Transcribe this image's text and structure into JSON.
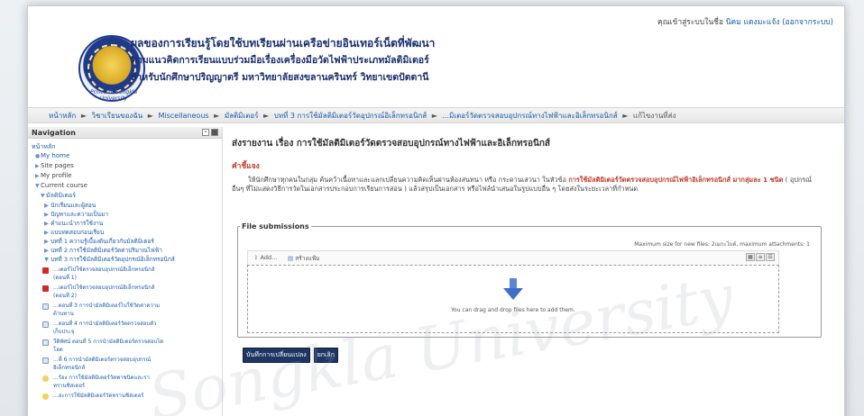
{
  "header": {
    "title_line1": "ผลของการเรียนรู้โดยใช้บทเรียนผ่านเครือข่ายอินเทอร์เน็ตที่พัฒนา",
    "title_line2": "ตามแนวคิดการเรียนแบบร่วมมือเรื่องเครื่องมือวัดไฟฟ้าประเภทมัลติมิเตอร์",
    "title_line3": "สำหรับนักศึกษาปริญญาตรี มหาวิทยาลัยสงขลานครินทร์ วิทยาเขตปัตตานี",
    "logo_caption": "Prince of Songkla University",
    "login_prefix": "คุณเข้าสู่ระบบในชื่อ",
    "login_user": "นิคม แดงมะแจ้ง",
    "logout_link": "(ออกจากระบบ)"
  },
  "breadcrumb": {
    "items": [
      "หน้าหลัก",
      "วิชาเรียนของฉัน",
      "Miscellaneous",
      "มัลติมิเตอร์",
      "บทที่ 3 การใช้มัลติมิเตอร์วัดอุปกรณ์อิเล็กทรอนิกส์",
      "...มิเตอร์วัดตรวจสอบอุปกรณ์ทางไฟฟ้าและอิเล็กทรอนิกส์",
      "แก้ไขงานที่ส่ง"
    ],
    "separator": "►"
  },
  "navigation": {
    "title": "Navigation",
    "home": "หน้าหลัก",
    "my_home": "My home",
    "site_pages": "Site pages",
    "my_profile": "My profile",
    "current_course": "Current course",
    "course": "มัลติมิเตอร์",
    "sections": [
      "นักเรียนและผู้สอน",
      "ปัญหาและความเป็นมา",
      "คำแนะนำการใช้งาน",
      "แบบทดสอบก่อนเรียน",
      "บทที่ 1 ความรู้เบื้องต้นเกี่ยวกับมัลติมิเตอร์",
      "บทที่ 2 การใช้มัลติมิเตอร์วัดค่าปริมาณไฟฟ้า",
      "บทที่ 3 การใช้มัลติมิเตอร์วัดอุปกรณ์อิเล็กทรอนิกส์"
    ],
    "activities": [
      {
        "icon": "pdf-icon",
        "line1": "...เตอร์ไปใช้ตรวจสอบอุปกรณ์อิเล็กทรอนิกส์",
        "line2": "(ตอนที่ 1)"
      },
      {
        "icon": "pdf-icon",
        "line1": "...เตอร์ไปใช้ตรวจสอบอุปกรณ์อิเล็กทรอนิกส์",
        "line2": "(ตอนที่ 2)"
      },
      {
        "icon": "doc-icon",
        "line1": "...ตอนที่ 3 การนำมัลติมิเตอร์ไปใช้วัดค่าความ",
        "line2": "ต้านทาน"
      },
      {
        "icon": "doc-icon",
        "line1": "...ตอนที่ 4 การนำมัลติมิเตอร์วัดตรวจสอบตัว",
        "line2": "เก็บประจุ"
      },
      {
        "icon": "doc-icon",
        "line1": "วีดิทัศน์ ตอนที่ 5 การนำมัลติมิเตอร์ตรวจสอบได",
        "line2": "โอด"
      },
      {
        "icon": "doc-icon",
        "line1": "...ที่ 6 การนำมัลติมิเตอร์ตรวจสอบอุปกรณ์",
        "line2": "อิเล็กทรอนิกส์"
      },
      {
        "icon": "forum-icon",
        "line1": "...ร้อง การใช้มัลติมิเตอร์วัดพาชนิดและรา",
        "line2": "ทรานซิสเตอร์"
      }
    ],
    "cut_off_line": "...ละการใช้มัลติมิเตอร์วัดทรานซิสเตอร์"
  },
  "main": {
    "heading": "ส่งรายงาน เรื่อง การใช้มัลติมิเตอร์วัดตรวจสอบอุปกรณ์ทางไฟฟ้าและอิเล็กทรอนิกส์",
    "section_title": "คำชี้แจง",
    "desc_part1": "ให้นักศึกษาทุกคนในกลุ่ม ค้นคว้าเนื้อหาและแลกเปลี่ยนความคิดเห็นผ่านห้องสนทนา หรือ กระดานเสวนา ในหัวข้อ ",
    "desc_bold": "การใช้มัลติมิเตอร์วัดตรวจสอบอุปกรณ์ไฟฟ้าอิเล็กทรอนิกส์ มากลุ่มละ 1 ชนิด",
    "desc_part2": " ( อุปกรณ์อื่นๆ ที่ไม่แสดงวิธีการวัดในเอกสารประกอบการเรียนการสอน ) แล้วสรุปเป็นเอกสาร หรือไฟล์นำเสนอในรูปแบบอื่น ๆ โดยส่งในระยะเวลาที่กำหนด",
    "file_submissions": {
      "legend": "File submissions",
      "max_info": "Maximum size for new files: 2เมกะไบต์, maximum attachments: 1",
      "add_label": "Add...",
      "create_folder_label": "สร้างแฟ้ม",
      "drop_text": "You can drag and drop files here to add them."
    },
    "save_button": "บันทึกการเปลี่ยนแปลง",
    "cancel_button": "ยกเลิก"
  },
  "watermark": "Songkla University"
}
